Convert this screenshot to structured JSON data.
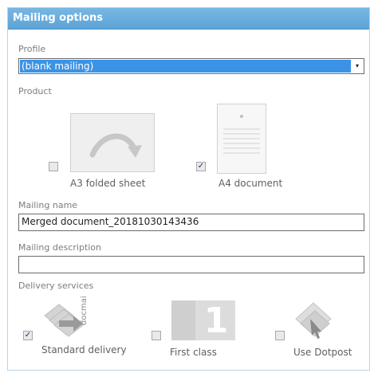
{
  "panel": {
    "title": "Mailing options"
  },
  "profile": {
    "label": "Profile",
    "selected": "(blank mailing)",
    "arrow": "▾"
  },
  "product": {
    "label": "Product",
    "options": [
      {
        "label": "A3 folded sheet",
        "checked": false,
        "icon": "a3-folded-sheet-icon"
      },
      {
        "label": "A4 document",
        "checked": true,
        "icon": "a4-document-icon"
      }
    ]
  },
  "mailing_name": {
    "label": "Mailing name",
    "value": "Merged document_20181030143436"
  },
  "mailing_description": {
    "label": "Mailing description",
    "value": ""
  },
  "delivery": {
    "label": "Delivery services",
    "options": [
      {
        "label": "Standard delivery",
        "checked": true,
        "icon": "docmail-icon",
        "icon_text": "docmail"
      },
      {
        "label": "First class",
        "checked": false,
        "icon": "first-class-icon",
        "icon_text": "1"
      },
      {
        "label": "Use Dotpost",
        "checked": false,
        "icon": "dotpost-icon"
      }
    ]
  },
  "colors": {
    "title_bar": "#5ea3d6",
    "selection": "#3a93e6",
    "label_text": "#7c7c7c"
  },
  "check_mark": "✓"
}
